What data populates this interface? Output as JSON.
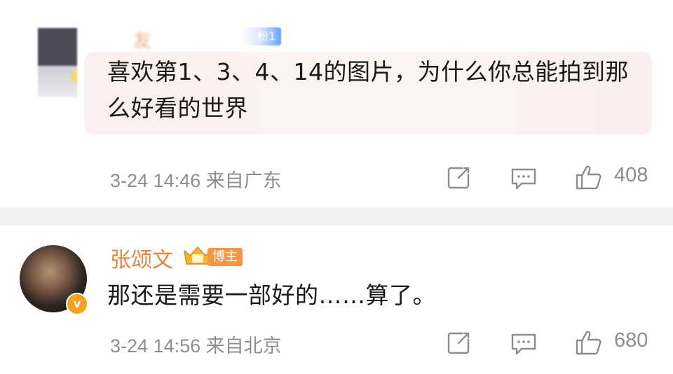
{
  "comments": [
    {
      "author_blurred": "友",
      "fan_badge": "粉1",
      "text": "喜欢第1、3、4、14的图片，为什么你总能拍到那么好看的世界",
      "time": "3-24 14:46",
      "location": "来自广东",
      "likes": "408"
    },
    {
      "author": "张颂文",
      "badge": "博主",
      "verified_mark": "v",
      "text": "那还是需要一部好的……算了。",
      "time": "3-24 14:56",
      "location": "来自北京",
      "likes": "680"
    }
  ],
  "icons": {
    "share": "share-icon",
    "reply": "comment-icon",
    "like": "thumbs-up-icon",
    "crown": "crown-icon"
  },
  "colors": {
    "username": "#e9823a",
    "badge": "#f59640",
    "meta": "#8d8d8d"
  }
}
